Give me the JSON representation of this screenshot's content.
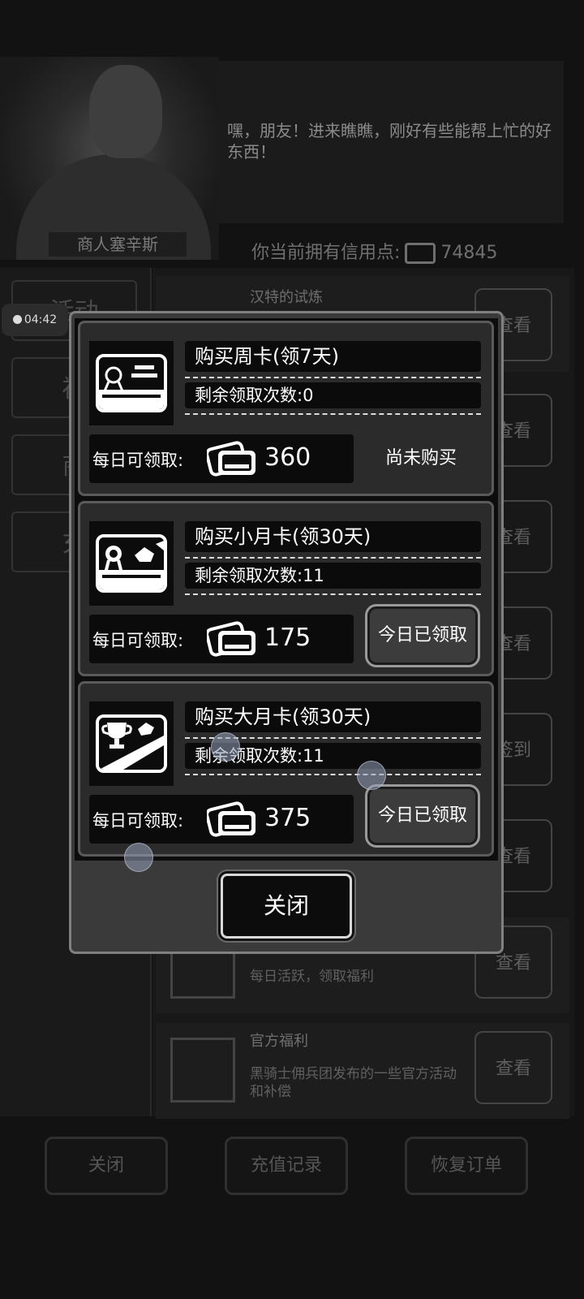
{
  "timer": {
    "time": "04:42"
  },
  "merchant": {
    "name": "商人塞辛斯",
    "dialog": "嘿，朋友！进来瞧瞧，刚好有些能帮上忙的好东西！",
    "credits_label": "你当前拥有信用点:",
    "credits_value": "74845"
  },
  "sidebar": {
    "items": [
      {
        "label": "活动"
      },
      {
        "label": "福"
      },
      {
        "label": "商"
      },
      {
        "label": "充"
      }
    ]
  },
  "list": {
    "rows": [
      {
        "title": "汉特的试炼",
        "button": "查看"
      },
      {
        "button": "查看"
      },
      {
        "button": "查看"
      },
      {
        "button": "查看"
      },
      {
        "button": "签到"
      },
      {
        "button": "查看"
      },
      {
        "desc": "每日活跃，领取福利",
        "button": "查看"
      },
      {
        "title": "官方福利",
        "desc": "黑骑士佣兵团发布的一些官方活动和补偿",
        "button": "查看"
      }
    ]
  },
  "bottom_bar": {
    "close": "关闭",
    "recharge_history": "充值记录",
    "restore_orders": "恢复订单"
  },
  "modal": {
    "daily_label": "每日可领取:",
    "cards": [
      {
        "title": "购买周卡(领7天)",
        "remaining": "剩余领取次数:0",
        "daily_value": "360",
        "status": "尚未购买",
        "icon": "week-card-icon"
      },
      {
        "title": "购买小月卡(领30天)",
        "remaining": "剩余领取次数:11",
        "daily_value": "175",
        "status": "今日已领取",
        "icon": "small-month-card-icon"
      },
      {
        "title": "购买大月卡(领30天)",
        "remaining": "剩余领取次数:11",
        "daily_value": "375",
        "status": "今日已领取",
        "icon": "big-month-card-icon"
      }
    ],
    "close_label": "关闭"
  }
}
